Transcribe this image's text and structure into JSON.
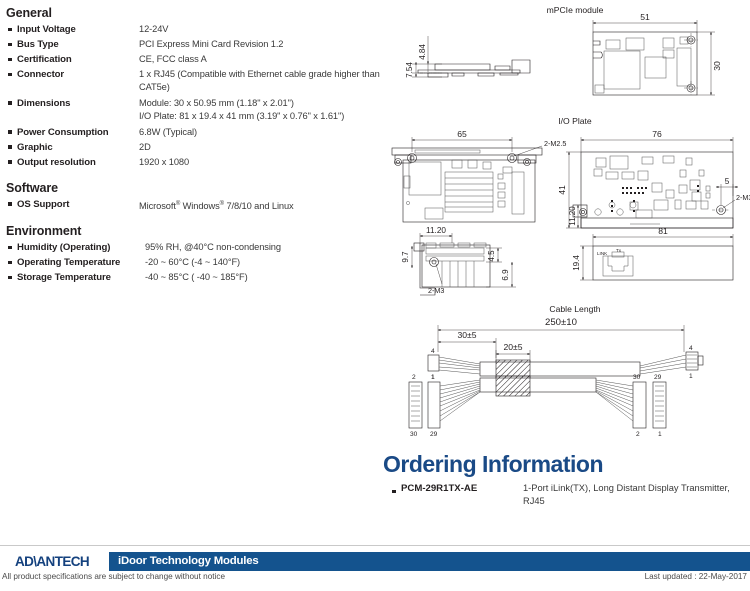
{
  "sections": [
    {
      "id": "general",
      "title": "General",
      "rows": [
        {
          "label": "Input Voltage",
          "value": "12-24V"
        },
        {
          "label": "Bus Type",
          "value": "PCI Express Mini Card Revision 1.2"
        },
        {
          "label": "Certification",
          "value": "CE, FCC class A"
        },
        {
          "label": "Connector",
          "value": "1 x RJ45 (Compatible with Ethernet cable grade higher than CAT5e)"
        },
        {
          "label": "Dimensions",
          "value": "Module: 30 x 50.95 mm (1.18\" x 2.01\")",
          "value2": "I/O Plate: 81 x 19.4 x 41 mm (3.19\" x 0.76\" x 1.61\")"
        },
        {
          "label": "Power Consumption",
          "value": "6.8W (Typical)"
        },
        {
          "label": "Graphic",
          "value": "2D"
        },
        {
          "label": "Output resolution",
          "value": "1920 x 1080"
        }
      ]
    },
    {
      "id": "software",
      "title": "Software",
      "rows": [
        {
          "label": "OS Support",
          "value_html": "Microsoft<sup>®</sup> Windows<sup>®</sup> 7/8/10 and Linux"
        }
      ]
    },
    {
      "id": "environment",
      "title": "Environment",
      "rows": [
        {
          "label": "Humidity (Operating)",
          "value": "95% RH, @40°C non-condensing"
        },
        {
          "label": "Operating Temperature",
          "value": "-20 ~ 60°C (-4 ~ 140°F)"
        },
        {
          "label": "Storage Temperature",
          "value": "-40 ~ 85°C ( -40 ~ 185°F)"
        }
      ]
    }
  ],
  "drawings": {
    "mpcie": {
      "caption": "mPCIe module",
      "dims": {
        "width": "51",
        "height": "30",
        "thick_top": "4.84",
        "thick_total": "7.54"
      }
    },
    "ioplate": {
      "caption": "I/O Plate",
      "dims": {
        "front_width": "65",
        "top_width": "76",
        "height": "41",
        "tab_height": "11.20",
        "offset": "5",
        "screw_front": "2-M2.5",
        "screw_top": "2-M3"
      }
    },
    "side": {
      "dims": {
        "width": "11.20",
        "left_height": "9.7",
        "step": "4.5",
        "total": "6.9",
        "screw": "2-M3"
      }
    },
    "face": {
      "dims": {
        "width": "81",
        "height": "19.4"
      },
      "labels": {
        "link": "LINK",
        "tx": "Tx"
      }
    },
    "cable": {
      "caption": "Cable Length",
      "dims": {
        "total": "250±10",
        "seg1": "30±5",
        "seg2": "20±5"
      },
      "pins": {
        "tl_top": "4",
        "tl_bottom": "1",
        "tr_top": "4",
        "tr_bottom": "1",
        "bl_a": "2",
        "bl_b": "1",
        "bl_a2": "30",
        "bl_b2": "29",
        "br_a": "30",
        "br_b": "29",
        "br_a2": "2",
        "br_b2": "1"
      }
    }
  },
  "ordering": {
    "title": "Ordering Information",
    "items": [
      {
        "sku": "PCM-29R1TX-AE",
        "desc": "1-Port iLink(TX), Long Distant Display Transmitter, RJ45"
      }
    ]
  },
  "footer": {
    "logo": "ADVANTECH",
    "logo_part1": "AD",
    "logo_slash": "\\",
    "logo_part2": "ANTECH",
    "title": "iDoor Technology Modules",
    "note": "All product specifications are subject to change without notice",
    "date": "Last updated : 22-May-2017"
  },
  "colors": {
    "brand_blue": "#14538e",
    "heading_blue": "#1a4a86",
    "text": "#231f20"
  }
}
